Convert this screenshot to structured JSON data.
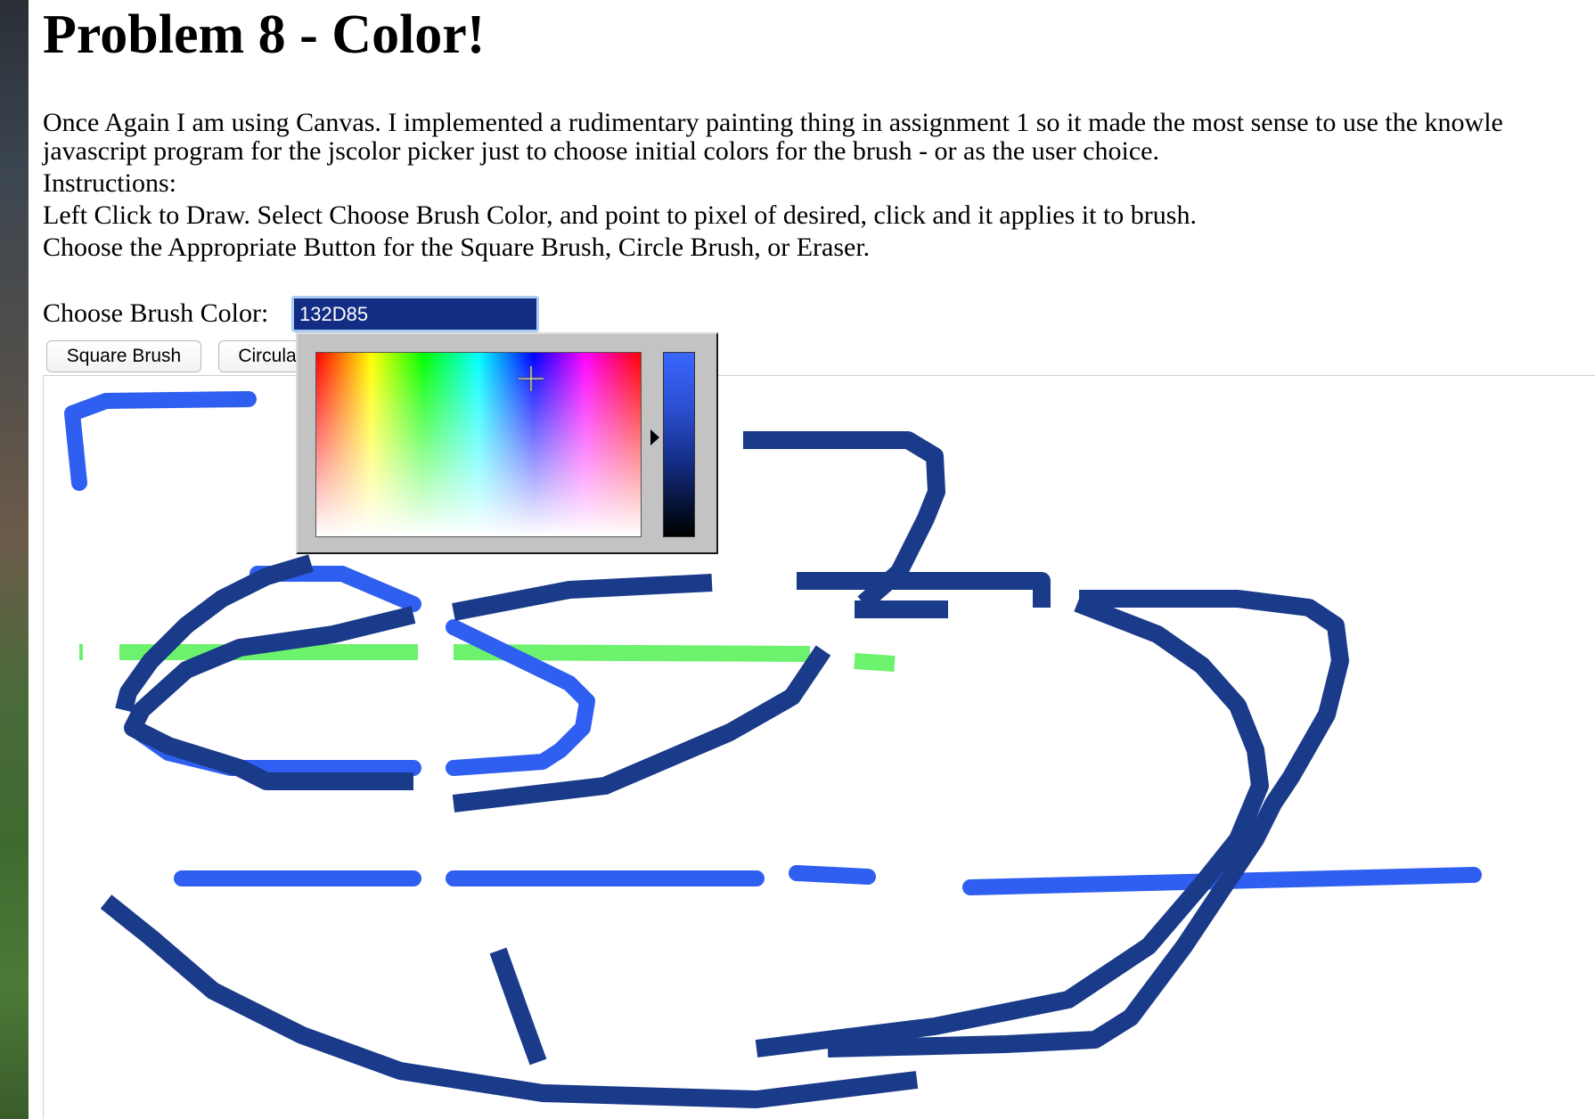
{
  "page": {
    "title": "Problem 8 - Color!",
    "paragraph_lines": [
      "Once Again I am using Canvas. I implemented a rudimentary painting thing in assignment 1 so it made the most sense to use the knowle",
      "javascript program for the jscolor picker just to choose initial colors for the brush - or as the user choice.",
      "Instructions:",
      "Left Click to Draw. Select Choose Brush Color, and point to pixel of desired, click and it applies it to brush.",
      "Choose the Appropriate Button for the Square Brush, Circle Brush, or Eraser."
    ]
  },
  "color_picker": {
    "label": "Choose Brush Color:",
    "value": "132D85",
    "value_color": "#132D85",
    "focus_ring_color": "#a9cdf2"
  },
  "buttons": {
    "square_brush": "Square Brush",
    "circular_brush": "Circula"
  },
  "canvas": {
    "stroke_colors": {
      "dark_blue": "#1a3a8a",
      "bright_blue": "#2f5ff0",
      "green": "#6cf26c"
    }
  }
}
